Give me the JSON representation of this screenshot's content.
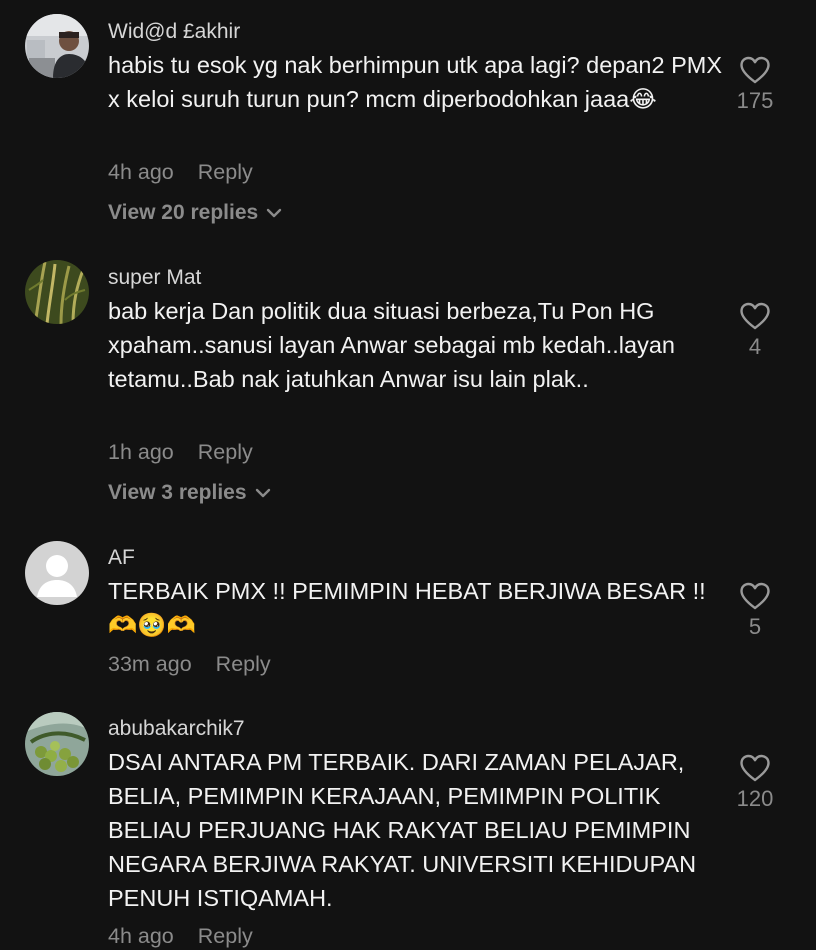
{
  "comments": [
    {
      "username": "Wid@d £akhir",
      "text": "habis tu esok yg nak berhimpun utk apa lagi? depan2 PMX x keloi suruh turun pun? mcm diperbodohkan jaaa😂",
      "time": "4h ago",
      "reply_label": "Reply",
      "view_replies": "View 20 replies",
      "likes": "175",
      "avatar_icon": "person-photo-avatar"
    },
    {
      "username": "super Mat",
      "text": "bab kerja Dan politik dua situasi berbeza,Tu Pon HG xpaham..sanusi layan Anwar sebagai mb kedah..layan tetamu..Bab nak jatuhkan Anwar isu lain plak..",
      "time": "1h ago",
      "reply_label": "Reply",
      "view_replies": "View 3 replies",
      "likes": "4",
      "avatar_icon": "rice-plant-avatar"
    },
    {
      "username": "AF",
      "text": "TERBAIK PMX !! PEMIMPIN HEBAT BERJIWA BESAR !! 🫶🥹🫶",
      "time": "33m ago",
      "reply_label": "Reply",
      "likes": "5",
      "avatar_icon": "default-user-avatar"
    },
    {
      "username": "abubakarchik7",
      "text": "DSAI ANTARA PM TERBAIK. DARI ZAMAN PELAJAR, BELIA, PEMIMPIN KERAJAAN, PEMIMPIN POLITIK BELIAU PERJUANG HAK RAKYAT BELIAU PEMIMPIN NEGARA BERJIWA RAKYAT. UNIVERSITI KEHIDUPAN PENUH ISTIQAMAH.",
      "time": "4h ago",
      "reply_label": "Reply",
      "likes": "120",
      "avatar_icon": "fruit-tree-avatar"
    }
  ],
  "colors": {
    "background": "#121212",
    "primary_text": "#f2f2f2",
    "secondary_text": "#8b8b8b",
    "icon": "#9a9a9a"
  }
}
